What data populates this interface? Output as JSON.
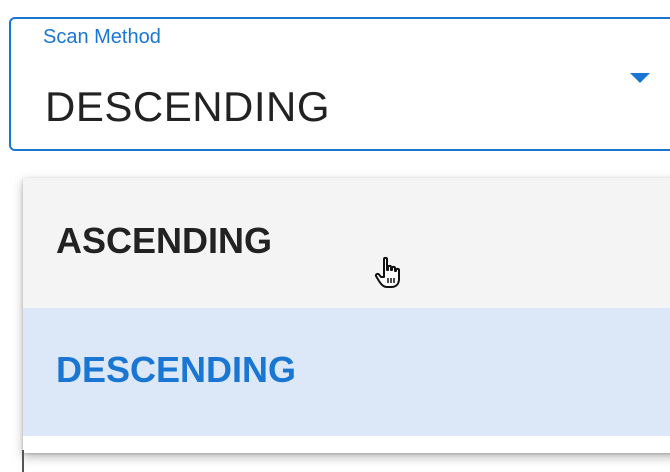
{
  "select": {
    "label": "Scan Method",
    "value": "DESCENDING",
    "icon": "arrow-drop-down-icon",
    "accent_color": "#1976d2"
  },
  "menu": {
    "options": [
      {
        "label": "ASCENDING",
        "selected": false,
        "hovered": true
      },
      {
        "label": "DESCENDING",
        "selected": true,
        "hovered": false
      }
    ],
    "selected_color": "#1976d2",
    "selected_bg": "#dce8f7",
    "hover_bg": "#f4f4f4"
  },
  "cursor": {
    "icon": "hand-pointer-icon"
  }
}
